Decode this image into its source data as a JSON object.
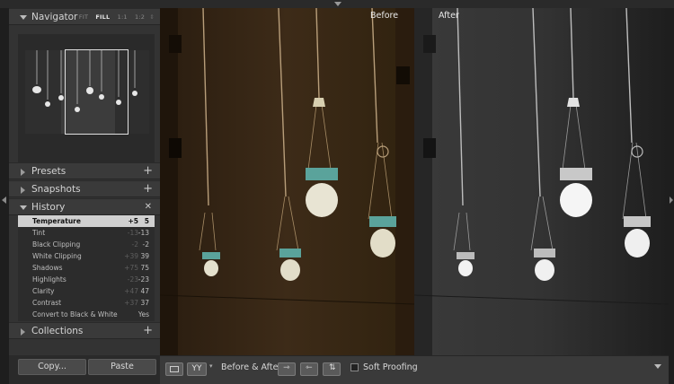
{
  "navigator": {
    "title": "Navigator",
    "options": [
      "FIT",
      "FILL",
      "1:1",
      "1:2"
    ],
    "active_option": "FILL"
  },
  "panels": {
    "presets": "Presets",
    "snapshots": "Snapshots",
    "history": "History",
    "collections": "Collections"
  },
  "history": [
    {
      "name": "Temperature",
      "before": "+5",
      "after": "5",
      "selected": true
    },
    {
      "name": "Tint",
      "before": "-13",
      "after": "-13"
    },
    {
      "name": "Black Clipping",
      "before": "-2",
      "after": "-2"
    },
    {
      "name": "White Clipping",
      "before": "+39",
      "after": "39"
    },
    {
      "name": "Shadows",
      "before": "+75",
      "after": "75"
    },
    {
      "name": "Highlights",
      "before": "-23",
      "after": "-23"
    },
    {
      "name": "Clarity",
      "before": "+47",
      "after": "47"
    },
    {
      "name": "Contrast",
      "before": "+37",
      "after": "37"
    },
    {
      "name": "Convert to Black & White",
      "before": "",
      "after": "Yes"
    }
  ],
  "buttons": {
    "copy": "Copy...",
    "paste": "Paste"
  },
  "view": {
    "before_label": "Before",
    "after_label": "After"
  },
  "toolbar": {
    "view_mode": "YY",
    "before_after_label": "Before & After :",
    "soft_proofing_label": "Soft Proofing"
  },
  "colors": {
    "panel_bg": "#333333",
    "selected_row": "#d0d0d0",
    "before_wall": "#3b2a17",
    "after_wall": "#3a3a3a",
    "lamp_glass": "#5aa39b"
  }
}
